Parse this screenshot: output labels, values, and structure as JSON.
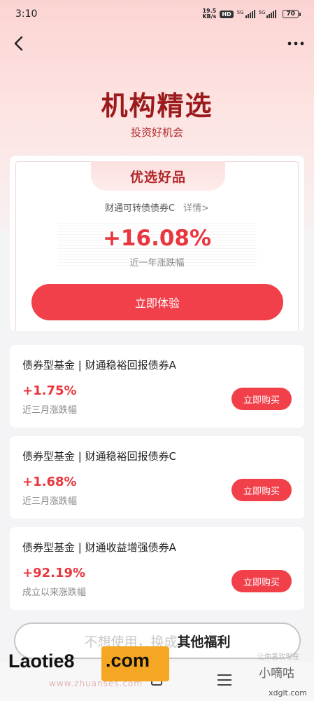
{
  "status_bar": {
    "time": "3:10",
    "net_speed_value": "19.5",
    "net_speed_unit": "KB/s",
    "hd_label": "HD",
    "sim1_label": "5G",
    "sim2_label": "5G",
    "battery": "70"
  },
  "header": {
    "title": "机构精选",
    "subtitle": "投资好机会"
  },
  "featured": {
    "ribbon_label": "优选好品",
    "fund_name": "财通可转债债券C",
    "detail_link": "详情>",
    "rate": "+16.08%",
    "rate_label": "近一年涨跌幅",
    "button_label": "立即体验"
  },
  "funds": [
    {
      "title": "债券型基金 | 财通稳裕回报债券A",
      "rate": "+1.75%",
      "rate_label": "近三月涨跌幅",
      "button_label": "立即购买"
    },
    {
      "title": "债券型基金 | 财通稳裕回报债券C",
      "rate": "+1.68%",
      "rate_label": "近三月涨跌幅",
      "button_label": "立即购买"
    },
    {
      "title": "债券型基金 | 财通收益增强债券A",
      "rate": "+92.19%",
      "rate_label": "成立以来涨跌幅",
      "button_label": "立即购买"
    }
  ],
  "bottom_bar": {
    "muted_text": "不想使用，换成",
    "strong_text": "其他福利"
  },
  "watermarks": {
    "left_text": "Laotie8",
    "left_box": ".com",
    "left_sub": "www.zhuanses.com",
    "right_top": "让你喜欢现在",
    "right_mid": "小嘀咕",
    "right_bot": "xdglt.com"
  },
  "colors": {
    "accent": "#f1404a",
    "rate_red": "#e8373e",
    "title_red": "#9b1b1d"
  }
}
